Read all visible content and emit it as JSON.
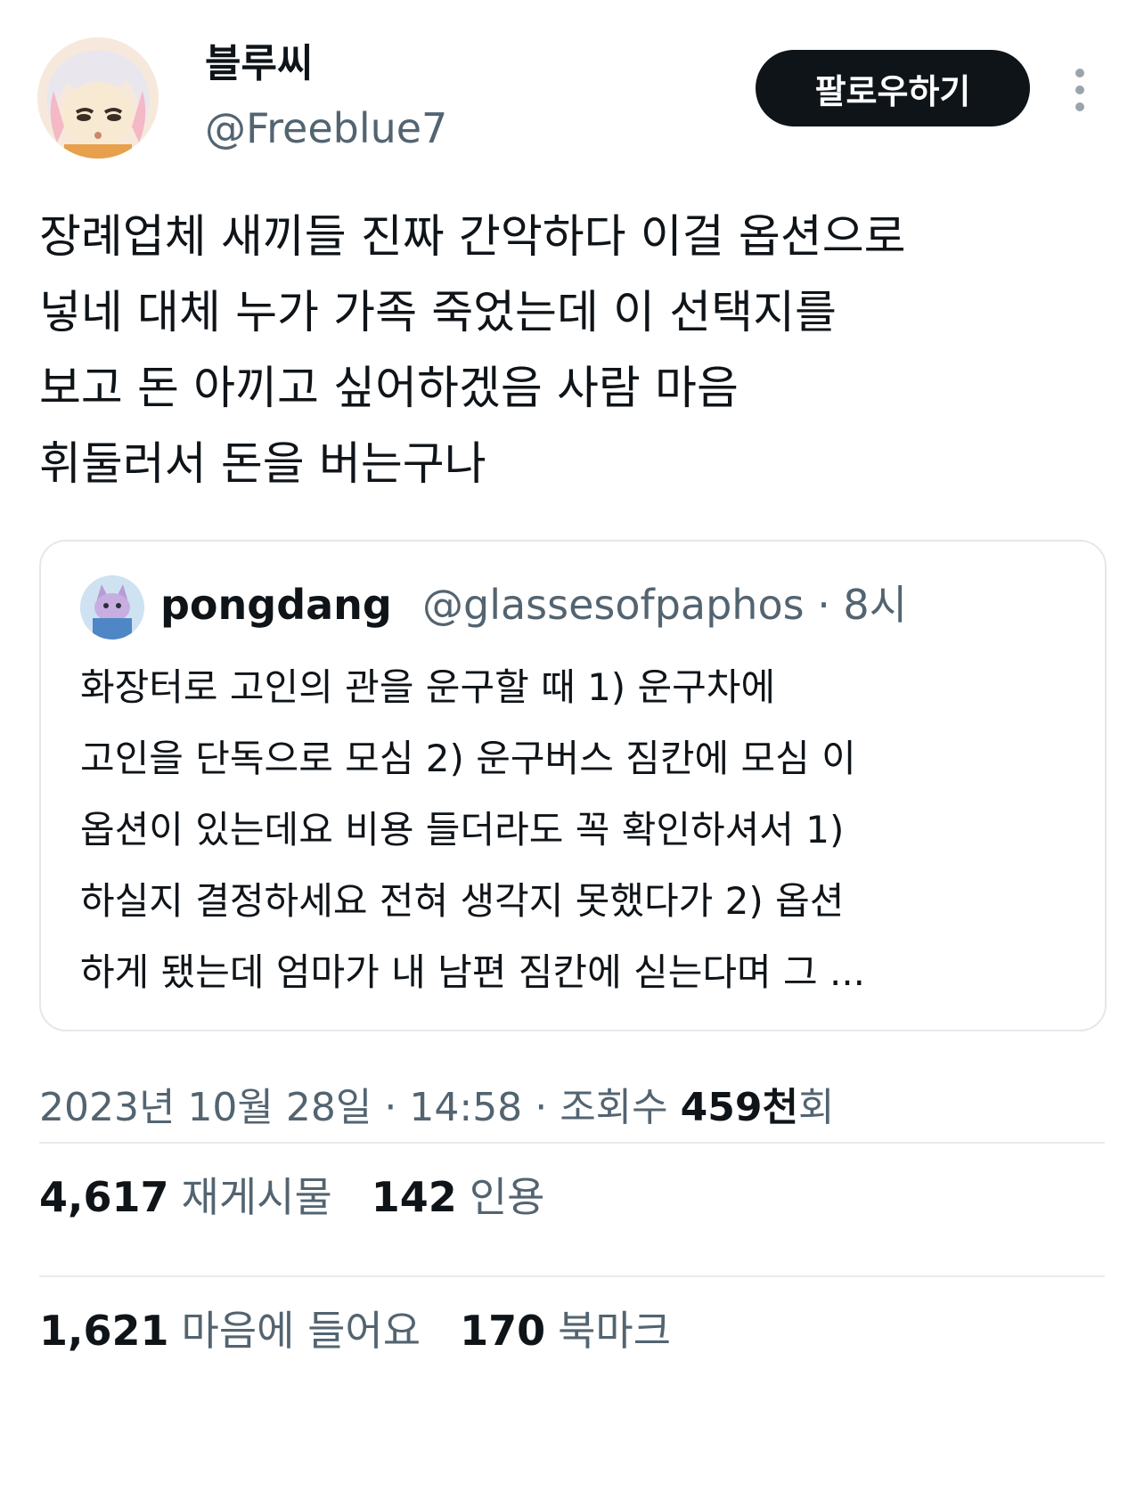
{
  "author": {
    "display_name": "블루씨",
    "handle": "@Freeblue7",
    "follow_label": "팔로우하기"
  },
  "tweet_lines": [
    "장례업체 새끼들 진짜 간악하다 이걸 옵션으로",
    "넣네 대체 누가 가족 죽었는데 이 선택지를",
    "보고 돈 아끼고 싶어하겠음 사람 마음",
    "휘둘러서 돈을 버는구나"
  ],
  "quoted": {
    "display_name": "pongdang",
    "handle": "@glassesofpaphos",
    "time": "· 8시",
    "lines": [
      "화장터로 고인의 관을 운구할 때 1) 운구차에",
      "고인을 단독으로 모심 2) 운구버스 짐칸에 모심 이",
      "옵션이 있는데요 비용 들더라도 꼭 확인하셔서 1)",
      "하실지 결정하세요 전혀 생각지 못했다가 2) 옵션",
      "하게 됐는데 엄마가 내 남편 짐칸에 싣는다며 그 ..."
    ]
  },
  "meta": {
    "date": "2023년 10월 28일",
    "time": "14:58",
    "views_label": "조회수",
    "views_count": "459천",
    "views_suffix": "회",
    "sep": "·"
  },
  "stats": {
    "retweets_count": "4,617",
    "retweets_label": "재게시물",
    "quotes_count": "142",
    "quotes_label": "인용",
    "likes_count": "1,621",
    "likes_label": "마음에 들어요",
    "bookmarks_count": "170",
    "bookmarks_label": "북마크"
  },
  "colors": {
    "text": "#0f1419",
    "secondary": "#536471",
    "border": "#e3e8ec",
    "button_bg": "#0f1419"
  }
}
